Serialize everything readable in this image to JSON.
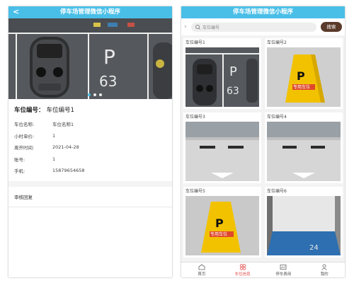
{
  "app_title": "停车场管理微信小程序",
  "detail": {
    "back": "<",
    "title_label": "车位编号：",
    "title_value": "车位编号1",
    "rows": [
      {
        "key": "车位名称:",
        "value": "车位名称1"
      },
      {
        "key": "小时单价:",
        "value": "1"
      },
      {
        "key": "离开时间:",
        "value": "2021-04-28"
      },
      {
        "key": "账号:",
        "value": "1"
      },
      {
        "key": "手机:",
        "value": "15879654658"
      }
    ],
    "review": "审核回复",
    "carousel_count": 3
  },
  "list": {
    "search_placeholder": "车位编号",
    "search_button": "搜索",
    "cards": [
      {
        "label": "车位编号1"
      },
      {
        "label": "车位编号2"
      },
      {
        "label": "车位编号3"
      },
      {
        "label": "车位编号4"
      },
      {
        "label": "车位编号5"
      },
      {
        "label": "车位编号6"
      }
    ]
  },
  "tabs": [
    {
      "label": "首页",
      "icon": "home-icon"
    },
    {
      "label": "车位信息",
      "icon": "grid-icon"
    },
    {
      "label": "停车费用",
      "icon": "ticket-icon"
    },
    {
      "label": "我的",
      "icon": "user-icon"
    }
  ],
  "sign_text": {
    "letter": "P",
    "word": "专用车位"
  },
  "stall_number": "63",
  "colors": {
    "header": "#49bfe7",
    "search_button": "#5a3a2a",
    "tab_active": "#e14b4b"
  }
}
